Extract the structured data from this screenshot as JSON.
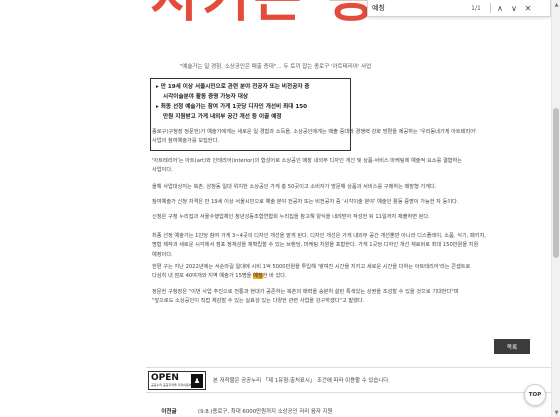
{
  "banner": {
    "text": "지키는 종로"
  },
  "findbar": {
    "query": "예칭",
    "count": "1/1",
    "prev_icon": "chevron-up-icon",
    "next_icon": "chevron-down-icon",
    "close_icon": "close-icon",
    "prev_glyph": "∧",
    "next_glyph": "∨",
    "close_glyph": "✕"
  },
  "article": {
    "subtitle": "\"예술가는 일 경험, 소상공인은 매출 증대\"… 두 토끼 잡는 종로구 '아트테리어' 사업",
    "summary": [
      "▸ 만 19세 이상 서울시민으로 관련 분야 전공자 또는 비전공자 중",
      "시각이술분야 활동 증명 가능자 대상",
      "▸ 최종 선정 예술가는 참여 가게 1곳당 디자인 개선비 최대 150",
      "만원 지원받고 가게 내외부 공간 개선 등 이끌 예정"
    ],
    "paragraphs": [
      {
        "lines": [
          "종로구(구청장 정문헌)가 예술가에게는 새로운 일 경험과 소득을, 소상공인에게는 매출 증대와 경쟁력 강화 방편을 제공하는 '우리동네가게 아트테리어'",
          "사업의 참여예술가를 모집한다."
        ]
      },
      {
        "lines": [
          "'아트테리어'는 아트(art)와 인테리어(interior)의 합성어로 소상공인 매장 내외부 디자인 개선 및 상품·서비스 마케팅에 예술적 요소를 결합하는",
          "사업이다."
        ]
      },
      {
        "lines": [
          "올해 사업대상지는 북촌, 삼청동 일대 위치한 소상공인 가게 총 50곳이고 소비자가 방문해 상품과 서비스를 구매하는 매장형 가게다."
        ]
      },
      {
        "lines": [
          "참여예술가 신청 자격은 만 19세 이상 서울시민으로 예술 분야 전공자 또는 비전공자 중 '시각이술 분야' 예술인 활동 증명이 가능한 자 등이다."
        ]
      },
      {
        "lines": [
          "신청은 구청 누리집과 서울수행업체인 청년성동조합연합회 누리집을 참고해 양식을 내려받아 작성한 뒤 11일까지 제출하면 된다."
        ]
      },
      {
        "lines": [
          "최종 선정 예술가는 1인당 참여 가게 3~4곳의 디자인 개선을 맡게 된다. 디자인 개선은 가게 내외부 공간 개선뿐만 아니라 디스플레이, 소품, 식기, 패키지,",
          "명함 제작과 새로운 시각에서 점포 정체성을 재확립할 수 있는 브랜딩, 마케팅 지원을 포함한다. 가게 1곳당 디자인 개선 재료비로 최대 150만원을 지원",
          "예정이다."
        ]
      },
      {
        "lines": [
          "한편 구는 지난 2022년에는 서순라길 일대에 시비 1억 5000만원을 투입해 '쌓여진 시간을 지키고 새로운 시간을 더하는 아트테리어'라는 콘셉트로",
          "다심히 내 점포 40여개와 지역 예술가 15명을 예칭한 바 있다."
        ]
      },
      {
        "lines": [
          "정문헌 구청장은 \"이번 사업 추진으로 전통과 현대가 공존하는 북촌의 매력을 승분히 살린 특색있는 상권을 조성할 수 있을 것으로 기대한다\"며",
          "\"앞으로도 소상공인이 직접 체감할 수 있는 실효성 있는 다양한 관련 사업을 강구하겠다\"고 말했다."
        ]
      }
    ],
    "highlight_word": "예칭"
  },
  "list_button": {
    "label": "목록"
  },
  "license": {
    "logo_word": "OPEN",
    "logo_sub": "공공누리  공공저작물 자유이용허락",
    "logo_person": "♟",
    "text": "본 저작물은 공공누리 「제 1유형:출처표시」 조건에 따라 이용할 수 있습니다."
  },
  "prev_post": {
    "label": "이전글",
    "title": "(9.8.)종로구, 최대 6000만원까지 소상공인 저리 융자 지원"
  },
  "top_button": {
    "label": "TOP"
  },
  "scrollbar": {
    "up_glyph": "▲",
    "down_glyph": "▼"
  },
  "colors": {
    "banner": "#e34b3a",
    "highlight": "#f5a623",
    "button_dark": "#3c3c3c"
  }
}
